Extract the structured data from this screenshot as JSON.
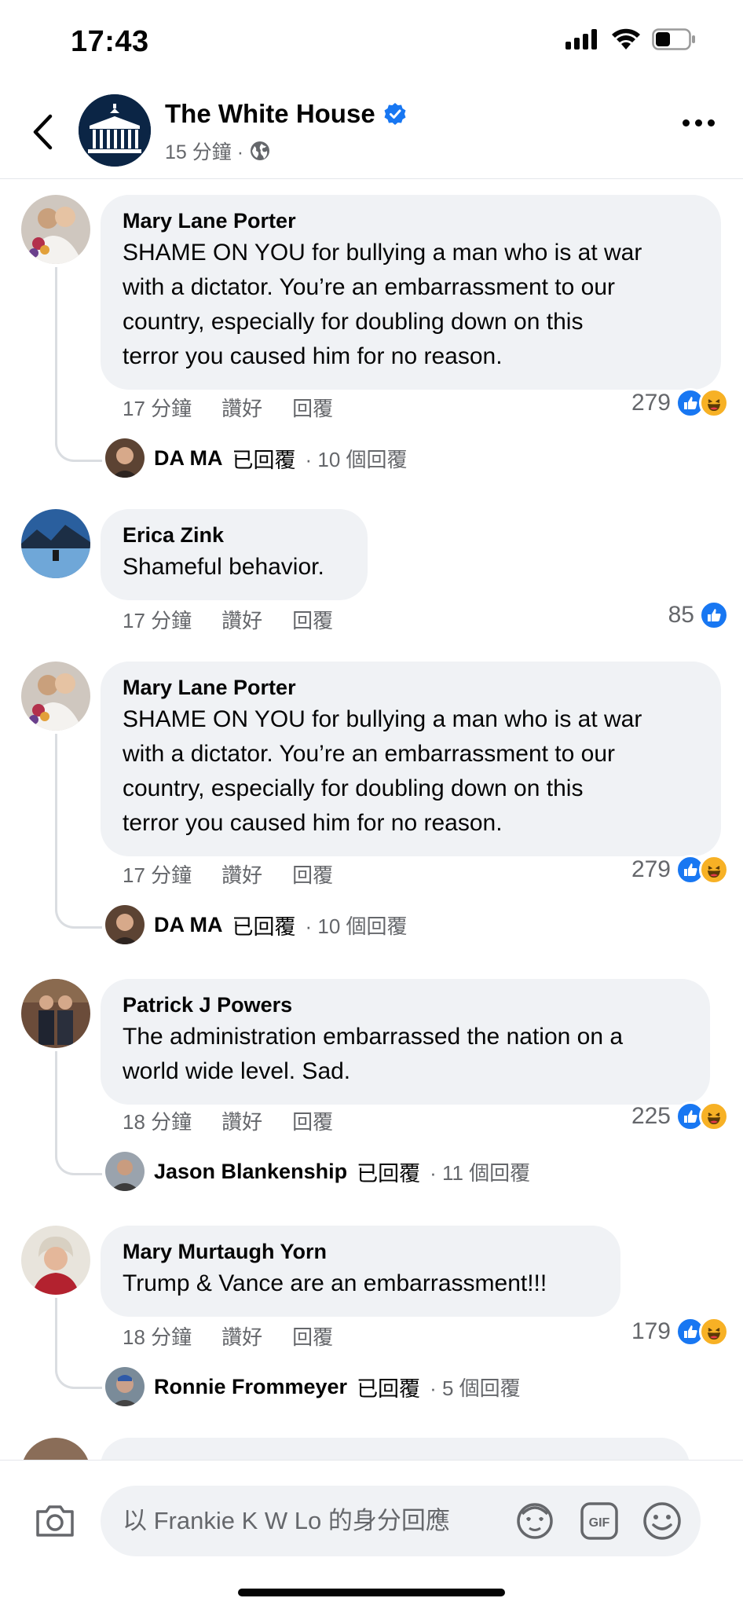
{
  "status_bar": {
    "time": "17:43"
  },
  "header": {
    "page_name": "The White House",
    "meta": "15 分鐘 ·"
  },
  "comments": [
    {
      "author": "Mary Lane Porter",
      "lines": [
        "SHAME ON YOU for bullying a man who is at war",
        "with a dictator. You’re an embarrassment to our",
        "country, especially for doubling down on this",
        "terror you caused him for no reason."
      ],
      "time": "17 分鐘",
      "like_label": "讚好",
      "reply_label": "回覆",
      "reaction_count": "279",
      "reply": {
        "name": "DA MA",
        "replied": "已回覆",
        "count": "· 10 個回覆"
      }
    },
    {
      "author": "Erica Zink",
      "lines": [
        "Shameful behavior."
      ],
      "time": "17 分鐘",
      "like_label": "讚好",
      "reply_label": "回覆",
      "reaction_count": "85"
    },
    {
      "author": "Mary Lane Porter",
      "lines": [
        "SHAME ON YOU for bullying a man who is at war",
        "with a dictator. You’re an embarrassment to our",
        "country, especially for doubling down on this",
        "terror you caused him for no reason."
      ],
      "time": "17 分鐘",
      "like_label": "讚好",
      "reply_label": "回覆",
      "reaction_count": "279",
      "reply": {
        "name": "DA MA",
        "replied": "已回覆",
        "count": "· 10 個回覆"
      }
    },
    {
      "author": "Patrick J Powers",
      "lines": [
        "The administration embarrassed the nation on a",
        "world wide level. Sad."
      ],
      "time": "18 分鐘",
      "like_label": "讚好",
      "reply_label": "回覆",
      "reaction_count": "225",
      "reply": {
        "name": "Jason Blankenship",
        "replied": "已回覆",
        "count": "· 11 個回覆"
      }
    },
    {
      "author": "Mary Murtaugh Yorn",
      "lines": [
        "Trump & Vance are an embarrassment!!!"
      ],
      "time": "18 分鐘",
      "like_label": "讚好",
      "reply_label": "回覆",
      "reaction_count": "179",
      "reply": {
        "name": "Ronnie Frommeyer",
        "replied": "已回覆",
        "count": "· 5 個回覆"
      }
    }
  ],
  "composer": {
    "placeholder": "以 Frankie K W Lo 的身分回應"
  },
  "colors": {
    "like_blue": "#1877f2",
    "haha_yellow": "#f7b125",
    "bubble_gray": "#f0f2f5",
    "meta_gray": "#65676b"
  },
  "icons": [
    "signal-icon",
    "wifi-icon",
    "battery-icon",
    "back-chevron-icon",
    "verified-badge-icon",
    "globe-icon",
    "more-icon",
    "like-reaction-icon",
    "haha-reaction-icon",
    "camera-icon",
    "avatar-sticker-icon",
    "gif-icon",
    "emoji-icon"
  ]
}
